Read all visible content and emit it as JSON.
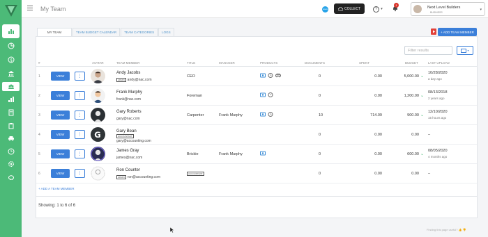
{
  "header": {
    "page_title": "My Team",
    "collect_label": "COLLECT",
    "help_label": "?",
    "notification_count": "1",
    "org_name": "Next Level Builders",
    "org_type": "BUSINESS"
  },
  "tabs": [
    {
      "label": "MY TEAM"
    },
    {
      "label": "TEAM BUDGET CALENDAR"
    },
    {
      "label": "TEAM CATEGORIES"
    },
    {
      "label": "LOGS"
    }
  ],
  "add_member_label": "+ ADD TEAM MEMBER",
  "filter_placeholder": "Filter results",
  "columns": {
    "avatar": "AVATAR",
    "member": "TEAM MEMBER",
    "title": "TITLE",
    "manager": "MANAGER",
    "products": "PRODUCTS",
    "documents": "DOCUMENTS",
    "spent": "SPENT",
    "budget": "BUDGET",
    "last_upload": "LAST UPLOAD"
  },
  "rows": [
    {
      "num": "1",
      "view": "VIEW",
      "more": "⋮",
      "name": "Andy Jacobs",
      "tag": "ADMIN",
      "email": "andy@nac.com",
      "title": "CEO",
      "manager": "",
      "documents": "0",
      "spent": "0.00",
      "budget": "5,000.00",
      "upload_date": "10/28/2020",
      "upload_ago": "a day ago"
    },
    {
      "num": "2",
      "view": "VIEW",
      "more": "⋮",
      "name": "Frank Murphy",
      "tag": "",
      "email": "frank@nac.com",
      "title": "Foreman",
      "manager": "",
      "documents": "0",
      "spent": "0.00",
      "budget": "1,200.00",
      "upload_date": "08/13/2018",
      "upload_ago": "2 years ago"
    },
    {
      "num": "3",
      "view": "VIEW",
      "more": "⋮",
      "name": "Gary Roberts",
      "tag": "",
      "email": "gary@nac.com",
      "title": "Carpenter",
      "manager": "Frank Murphy",
      "documents": "10",
      "spent": "714.09",
      "budget": "900.00",
      "upload_date": "12/10/2020",
      "upload_ago": "15 hours ago"
    },
    {
      "num": "4",
      "view": "VIEW",
      "more": "⋮",
      "name": "Gary Bean",
      "tag": "ACCOUNTANT",
      "email": "gary@accounting.com",
      "title": "",
      "manager": "",
      "documents": "0",
      "spent": "0.00",
      "budget": "0.00",
      "upload_date": "–",
      "upload_ago": ""
    },
    {
      "num": "5",
      "view": "VIEW",
      "more": "⋮",
      "name": "James Gray",
      "tag": "",
      "email": "james@nac.com",
      "title": "Brickie",
      "manager": "Frank Murphy",
      "documents": "0",
      "spent": "0.00",
      "budget": "600.00",
      "upload_date": "08/05/2020",
      "upload_ago": "4 months ago"
    },
    {
      "num": "6",
      "view": "VIEW",
      "more": "⋮",
      "name": "Ron Counter",
      "tag": "ADMIN",
      "email": "ron@accounting.com",
      "title": "ACCOUNTANT",
      "manager": "",
      "documents": "0",
      "spent": "0.00",
      "budget": "0.00",
      "upload_date": "–",
      "upload_ago": ""
    }
  ],
  "add_team_member_link": "+ ADD A TEAM MEMBER",
  "showing": "Showing: 1 to 6 of 6",
  "feedback": "Finding this page useful?",
  "colors": {
    "sidebar": "#4cba78",
    "primary": "#3b7fd9"
  }
}
